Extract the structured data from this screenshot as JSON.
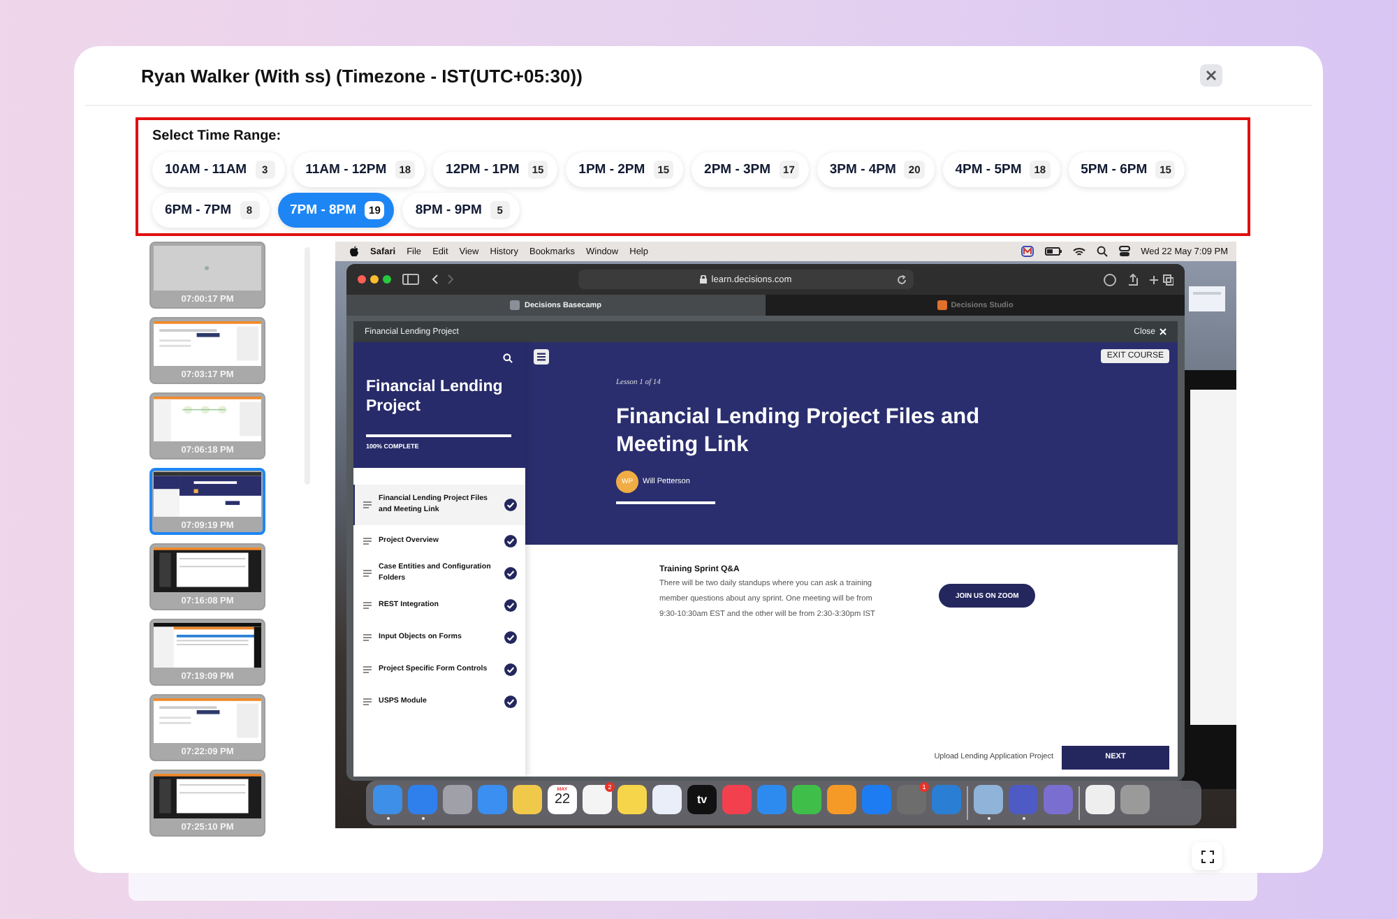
{
  "dialog": {
    "title": "Ryan Walker (With ss) (Timezone - IST(UTC+05:30))"
  },
  "time_range": {
    "label": "Select Time Range:",
    "options": [
      {
        "label": "10AM - 11AM",
        "count": "3",
        "selected": false
      },
      {
        "label": "11AM - 12PM",
        "count": "18",
        "selected": false
      },
      {
        "label": "12PM - 1PM",
        "count": "15",
        "selected": false
      },
      {
        "label": "1PM - 2PM",
        "count": "15",
        "selected": false
      },
      {
        "label": "2PM - 3PM",
        "count": "17",
        "selected": false
      },
      {
        "label": "3PM - 4PM",
        "count": "20",
        "selected": false
      },
      {
        "label": "4PM - 5PM",
        "count": "18",
        "selected": false
      },
      {
        "label": "5PM - 6PM",
        "count": "15",
        "selected": false
      },
      {
        "label": "6PM - 7PM",
        "count": "8",
        "selected": false
      },
      {
        "label": "7PM - 8PM",
        "count": "19",
        "selected": true
      },
      {
        "label": "8PM - 9PM",
        "count": "5",
        "selected": false
      }
    ]
  },
  "thumbnails": [
    {
      "time": "07:00:17 PM",
      "kind": "blank",
      "selected": false
    },
    {
      "time": "07:03:17 PM",
      "kind": "form",
      "selected": false
    },
    {
      "time": "07:06:18 PM",
      "kind": "flow",
      "selected": false
    },
    {
      "time": "07:09:19 PM",
      "kind": "course",
      "selected": true
    },
    {
      "time": "07:16:08 PM",
      "kind": "dark",
      "selected": false
    },
    {
      "time": "07:19:09 PM",
      "kind": "table",
      "selected": false
    },
    {
      "time": "07:22:09 PM",
      "kind": "form",
      "selected": false
    },
    {
      "time": "07:25:10 PM",
      "kind": "dark",
      "selected": false
    }
  ],
  "screenshot": {
    "menu_bar": {
      "app": "Safari",
      "items": [
        "File",
        "Edit",
        "View",
        "History",
        "Bookmarks",
        "Window",
        "Help"
      ],
      "clock": "Wed 22 May  7:09 PM"
    },
    "browser": {
      "address": "learn.decisions.com",
      "tabs": [
        {
          "label": "Decisions Basecamp",
          "selected": true
        },
        {
          "label": "Decisions Studio",
          "selected": false
        }
      ]
    },
    "course_window": {
      "title": "Financial Lending Project",
      "close": "Close",
      "course_title": "Financial Lending Project",
      "progress_label": "100% COMPLETE",
      "progress": {
        "level": 1
      },
      "lessons": [
        {
          "title": "Financial Lending Project Files and Meeting Link",
          "selected": true,
          "completed": true
        },
        {
          "title": "Project Overview",
          "selected": false,
          "completed": true
        },
        {
          "title": "Case Entities and Configuration Folders",
          "selected": false,
          "completed": true
        },
        {
          "title": "REST Integration",
          "selected": false,
          "completed": true
        },
        {
          "title": "Input Objects on Forms",
          "selected": false,
          "completed": true
        },
        {
          "title": "Project Specific Form Controls",
          "selected": false,
          "completed": true
        },
        {
          "title": "USPS Module",
          "selected": false,
          "completed": true
        }
      ],
      "exit_button": "EXIT COURSE",
      "lesson_count": "Lesson 1 of 14",
      "lesson_title": "Financial Lending Project Files and Meeting Link",
      "author_initials": "WP",
      "author": "Will Petterson",
      "section_title": "Training Sprint Q&A",
      "section_text": "There will be two daily standups where you can ask a training member questions about any sprint. One meeting will be from 9:30-10:30am EST and the other will be from 2:30-3:30pm IST",
      "zoom_button": "JOIN US ON ZOOM",
      "next_lesson": "Upload Lending Application Project",
      "next_button": "NEXT"
    },
    "dock": [
      {
        "kind": "app",
        "color": "#3d8fe8",
        "running": true
      },
      {
        "kind": "app",
        "color": "#2f80ed",
        "running": true
      },
      {
        "kind": "app",
        "color": "#a0a0a8",
        "running": false
      },
      {
        "kind": "app",
        "color": "#3b8ff0",
        "running": false
      },
      {
        "kind": "app",
        "color": "#f1c94a",
        "running": false
      },
      {
        "kind": "calendar",
        "color": "#ffffff",
        "month": "MAY",
        "day": "22",
        "running": false
      },
      {
        "kind": "app",
        "color": "#f4f4f4",
        "badge": "2",
        "running": false
      },
      {
        "kind": "app",
        "color": "#f7d54a",
        "running": false
      },
      {
        "kind": "app",
        "color": "#e9eef8",
        "running": false
      },
      {
        "kind": "text",
        "color": "#111111",
        "label": "tv",
        "running": false
      },
      {
        "kind": "app",
        "color": "#f2404f",
        "running": false
      },
      {
        "kind": "app",
        "color": "#2d8bf0",
        "running": false
      },
      {
        "kind": "app",
        "color": "#3fbf4a",
        "running": false
      },
      {
        "kind": "app",
        "color": "#f59a27",
        "running": false
      },
      {
        "kind": "app",
        "color": "#1e7cf2",
        "running": false
      },
      {
        "kind": "app",
        "color": "#6d6d6d",
        "badge": "1",
        "running": false
      },
      {
        "kind": "app",
        "color": "#2a7fd4",
        "running": false
      },
      {
        "kind": "separator"
      },
      {
        "kind": "app",
        "color": "#8fb3d9",
        "running": true
      },
      {
        "kind": "app",
        "color": "#4f5bc4",
        "running": true
      },
      {
        "kind": "app",
        "color": "#7a6fd0",
        "running": false
      },
      {
        "kind": "separator"
      },
      {
        "kind": "app",
        "color": "#eeeeee",
        "running": false
      },
      {
        "kind": "app",
        "color": "#9a9a9a",
        "running": false
      }
    ]
  }
}
